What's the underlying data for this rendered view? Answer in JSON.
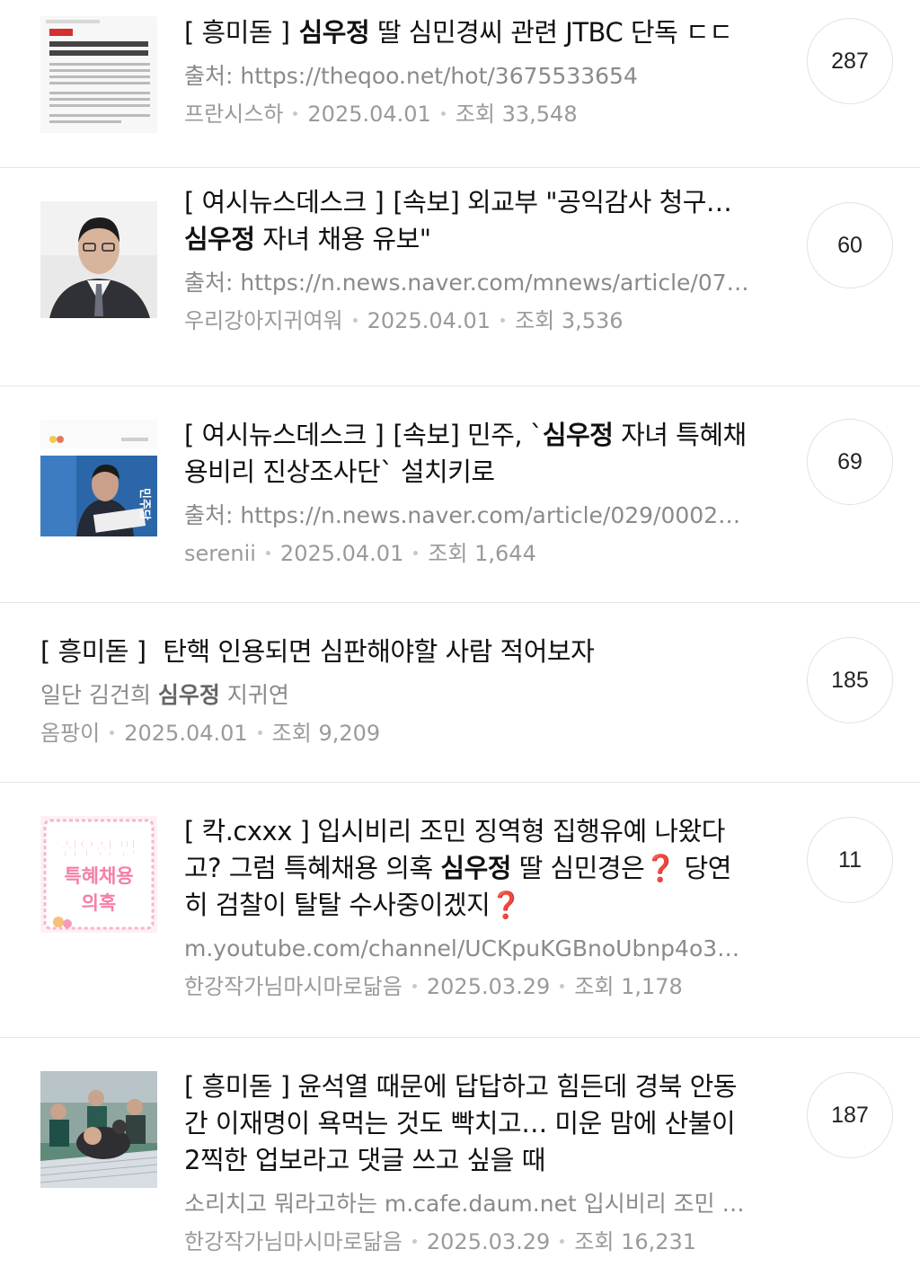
{
  "posts": [
    {
      "tag": "[ 흥미돋 ]",
      "title_bold": "심우정",
      "title_rest": " 딸 심민경씨 관련 JTBC 단독 ㄷㄷ",
      "source": "출처: https://theqoo.net/hot/3675533654",
      "author": "프란시스하",
      "date": "2025.04.01",
      "views": "조회 33,548",
      "comments": "287",
      "thumb_text": {
        "badge": "JTBC 단독",
        "headline1": "'연구보조원' 경력 내민 심우정 딸",
        "headline2": "서울대 연구소 책자에 이름 없었다"
      }
    },
    {
      "tag": "[ 여시뉴스데스크 ]",
      "title_pre": "[속보] 외교부 \"공익감사 청구…",
      "title_bold": "심우정",
      "title_rest": " 자녀 채용 유보\"",
      "source": "출처: https://n.news.naver.com/mnews/article/079…",
      "author": "우리강아지귀여워",
      "date": "2025.04.01",
      "views": "조회 3,536",
      "comments": "60"
    },
    {
      "tag": "[ 여시뉴스데스크 ]",
      "title_pre": "[속보] 민주, `",
      "title_bold": "심우정",
      "title_rest": " 자녀 특혜채용비리 진상조사단` 설치키로",
      "source": "출처: https://n.news.naver.com/article/029/00029…",
      "author": "serenii",
      "date": "2025.04.01",
      "views": "조회 1,644",
      "comments": "69",
      "thumb_text": {
        "wall": "민주당"
      }
    },
    {
      "tag": "[ 흥미돋 ]",
      "title_rest": " 탄핵 인용되면 심판해야할 사람 적어보자",
      "desc_pre": "일단 김건희 ",
      "desc_bold": "심우정",
      "desc_rest": " 지귀연",
      "author": "옴팡이",
      "date": "2025.04.01",
      "views": "조회 9,209",
      "comments": "185"
    },
    {
      "tag": "[ 칵.cxxx ]",
      "title_pre": " 입시비리 조민 징역형 집행유예 나왔다고?  그럼 특혜채용 의혹 ",
      "title_bold": "심우정",
      "title_mid": " 딸 심민경은",
      "title_q1": "❓",
      "title_rest": " 당연히 검찰이 탈탈 수사중이겠지",
      "title_q2": "❓",
      "source": "m.youtube.com/channel/UCKpuKGBnoUbnp4o35IE…",
      "author": "한강작가님마시마로닮음",
      "date": "2025.03.29",
      "views": "조회 1,178",
      "comments": "11",
      "thumb_text": {
        "line1": "심우정 딸",
        "line2": "특혜채용",
        "line3": "의혹"
      }
    },
    {
      "tag": "[ 흥미돋 ]",
      "title_rest": " 윤석열 때문에 답답하고 힘든데 경북 안동 간 이재명이 욕먹는 것도 빡치고… 미운 맘에 산불이 2찍한 업보라고 댓글 쓰고 싶을 때",
      "desc_pre": "소리치고 뭐라고하는 m.cafe.daum.net 입시비리 조민 징…",
      "author": "한강작가님마시마로닮음",
      "date": "2025.03.29",
      "views": "조회 16,231",
      "comments": "187"
    }
  ],
  "colors": {
    "accent_red": "#e0314a",
    "thumb_pink": "#f47fa8",
    "border": "#e6e6e6"
  }
}
